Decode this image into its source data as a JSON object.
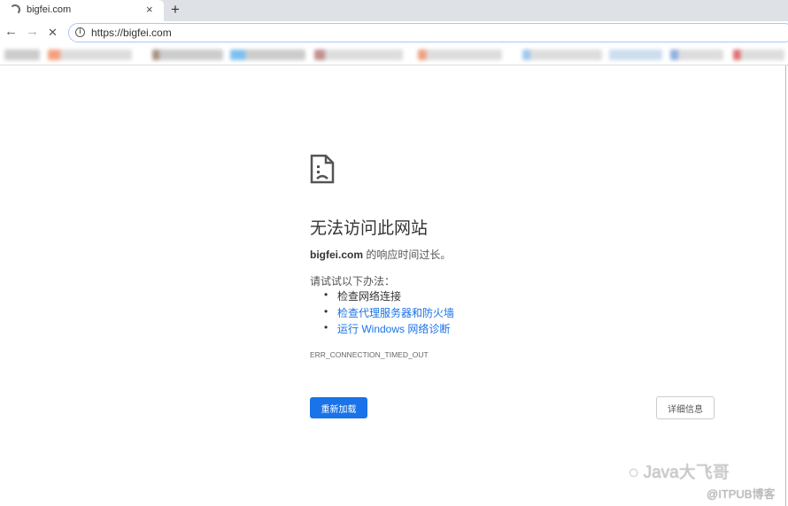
{
  "browser": {
    "tab_title": "bigfei.com",
    "url": "https://bigfei.com",
    "new_tab": "+",
    "close": "×",
    "back": "←",
    "forward": "→",
    "stop": "✕"
  },
  "error": {
    "title": "无法访问此网站",
    "domain": "bigfei.com",
    "message": " 的响应时间过长。",
    "try_label": "请试试以下办法：",
    "suggestions": [
      {
        "label": "检查网络连接",
        "link": false
      },
      {
        "label": "检查代理服务器和防火墙",
        "link": true
      },
      {
        "label": "运行 Windows 网络诊断",
        "link": true
      }
    ],
    "code": "ERR_CONNECTION_TIMED_OUT",
    "reload_label": "重新加载",
    "details_label": "详细信息"
  },
  "watermark": {
    "name": "Java大飞哥",
    "source": "@ITPUB博客"
  },
  "colors": {
    "accent": "#1a73e8"
  }
}
